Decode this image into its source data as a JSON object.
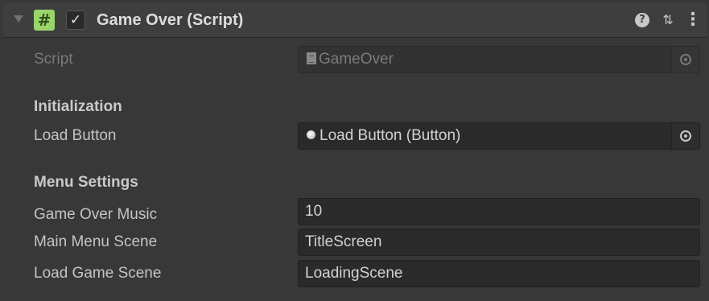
{
  "component": {
    "title": "Game Over (Script)",
    "enabled": true,
    "script_icon_glyph": "#",
    "enabled_check_glyph": "✓",
    "header_icons": [
      "help-icon",
      "presets-icon",
      "context-menu-icon"
    ],
    "help_glyph": "?",
    "presets_glyph": "⇅",
    "menu_glyph": "⋮"
  },
  "script_field": {
    "label": "Script",
    "value": "GameOver",
    "icon": "script-file-icon"
  },
  "sections": {
    "initialization": {
      "header": "Initialization",
      "load_button": {
        "label": "Load Button",
        "value": "Load Button (Button)",
        "icon": "button-object-icon"
      }
    },
    "menu_settings": {
      "header": "Menu Settings",
      "game_over_music": {
        "label": "Game Over Music",
        "value": "10"
      },
      "main_menu_scene": {
        "label": "Main Menu Scene",
        "value": "TitleScreen"
      },
      "load_game_scene": {
        "label": "Load Game Scene",
        "value": "LoadingScene"
      }
    }
  },
  "colors": {
    "background": "#383838",
    "header": "#3e3e3e",
    "field": "#2a2a2a",
    "script_icon": "#9ad56c"
  }
}
